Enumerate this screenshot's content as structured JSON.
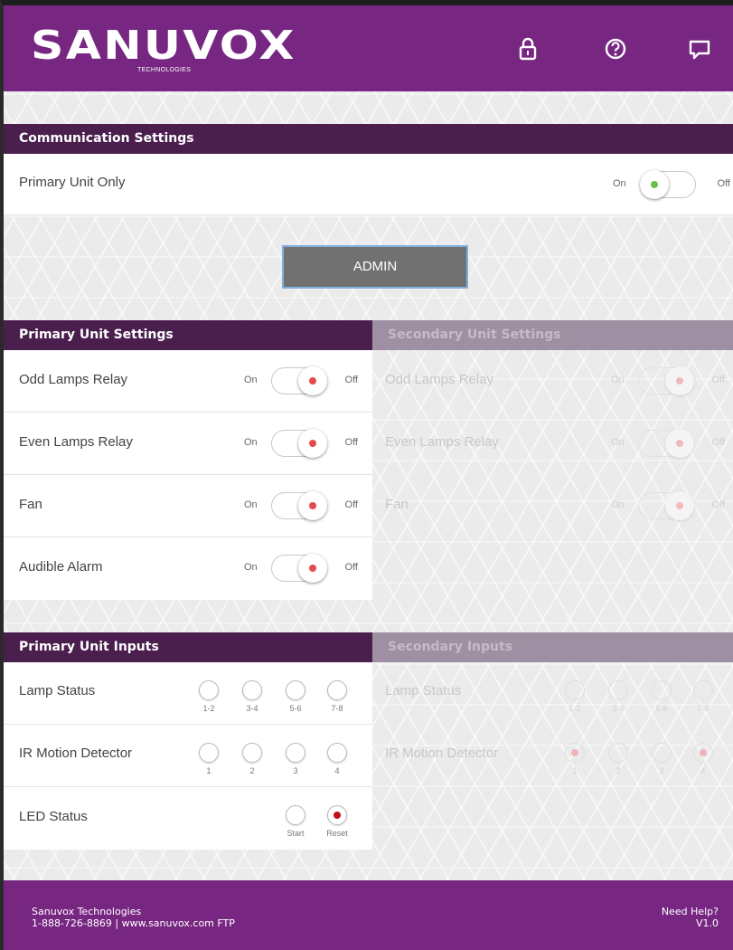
{
  "header": {
    "brand": "SANUVOX",
    "brand_sub": "TECHNOLOGIES",
    "icons": [
      "lock-icon",
      "help-icon",
      "chat-icon"
    ]
  },
  "communication": {
    "title": "Communication Settings",
    "primary_only_label": "Primary Unit Only",
    "on": "On",
    "off": "Off"
  },
  "admin_label": "ADMIN",
  "primary_settings": {
    "title": "Primary Unit Settings",
    "on": "On",
    "off": "Off",
    "rows": [
      {
        "label": "Odd Lamps Relay"
      },
      {
        "label": "Even Lamps Relay"
      },
      {
        "label": "Fan"
      },
      {
        "label": "Audible Alarm"
      }
    ]
  },
  "secondary_settings": {
    "title": "Secondary Unit Settings",
    "on": "On",
    "off": "Off",
    "rows": [
      {
        "label": "Odd Lamps Relay"
      },
      {
        "label": "Even Lamps Relay"
      },
      {
        "label": "Fan"
      }
    ]
  },
  "primary_inputs": {
    "title": "Primary Unit Inputs",
    "lamp_status": {
      "label": "Lamp Status",
      "caps": [
        "1-2",
        "3-4",
        "5-6",
        "7-8"
      ]
    },
    "ir_motion": {
      "label": "IR Motion Detector",
      "caps": [
        "1",
        "2",
        "3",
        "4"
      ]
    },
    "led_status": {
      "label": "LED Status",
      "caps": [
        "Start",
        "Reset"
      ]
    }
  },
  "secondary_inputs": {
    "title": "Secondary Inputs",
    "lamp_status": {
      "label": "Lamp Status",
      "caps": [
        "1-2",
        "3-4",
        "5-6",
        "7-8"
      ]
    },
    "ir_motion": {
      "label": "IR Motion Detector",
      "caps": [
        "1",
        "2",
        "3",
        "4"
      ]
    }
  },
  "footer": {
    "company": "Sanuvox Technologies",
    "contact": "1-888-726-8869 | www.sanuvox.com FTP",
    "help": "Need Help?",
    "version": "V1.0"
  },
  "colors": {
    "brand_purple": "#772782",
    "section_bar": "#4a1f4e",
    "toggle_on_dot": "#6cc04a",
    "toggle_off_dot": "#e54b4b",
    "led_active": "#c0101a"
  }
}
